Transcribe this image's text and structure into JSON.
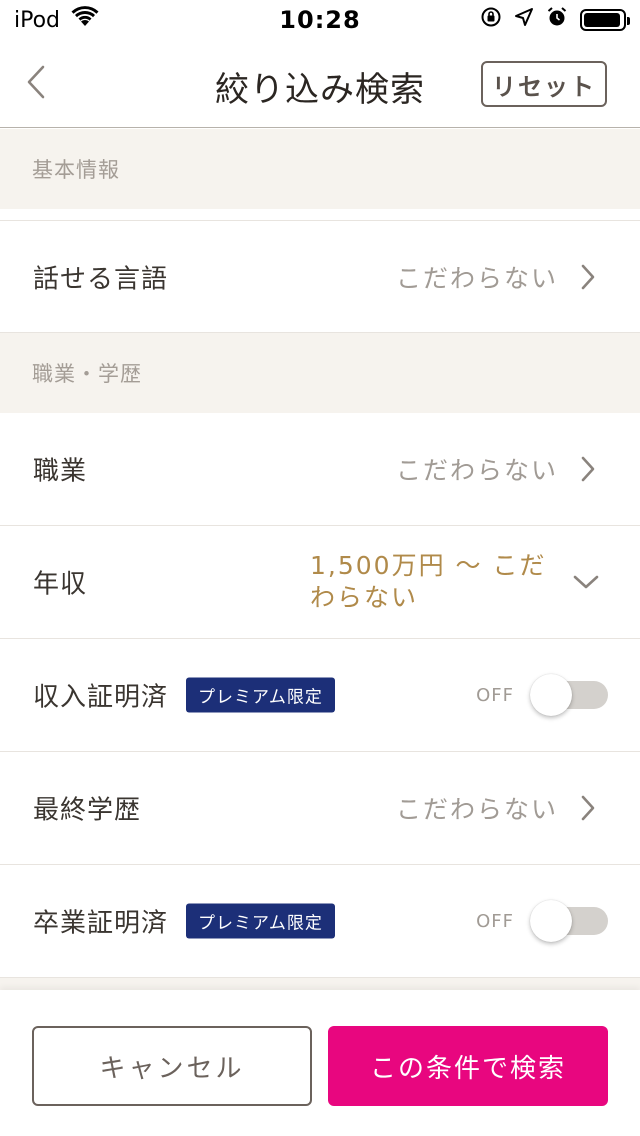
{
  "status_bar": {
    "carrier": "iPod",
    "time": "10:28",
    "icons": [
      "wifi-icon",
      "orientation-lock-icon",
      "location-arrow-icon",
      "alarm-icon",
      "battery-icon"
    ]
  },
  "nav": {
    "title": "絞り込み検索",
    "reset_label": "リセット",
    "back_icon": "chevron-left-icon"
  },
  "sections": {
    "basic": "基本情報",
    "career": "職業・学歴"
  },
  "rows": {
    "language": {
      "label": "話せる言語",
      "value": "こだわらない"
    },
    "occupation": {
      "label": "職業",
      "value": "こだわらない"
    },
    "income": {
      "label": "年収",
      "value": "1,500万円 〜 こだわらない"
    },
    "income_verified": {
      "label": "収入証明済",
      "badge": "プレミアム限定",
      "state": "OFF"
    },
    "education": {
      "label": "最終学歴",
      "value": "こだわらない"
    },
    "graduation_verified": {
      "label": "卒業証明済",
      "badge": "プレミアム限定",
      "state": "OFF"
    }
  },
  "footer": {
    "cancel_label": "キャンセル",
    "search_label": "この条件で検索"
  },
  "colors": {
    "accent_pink": "#e8067f",
    "premium_navy": "#1c2f78",
    "highlight_gold": "#b08a4a",
    "section_bg": "#f6f3ee"
  }
}
